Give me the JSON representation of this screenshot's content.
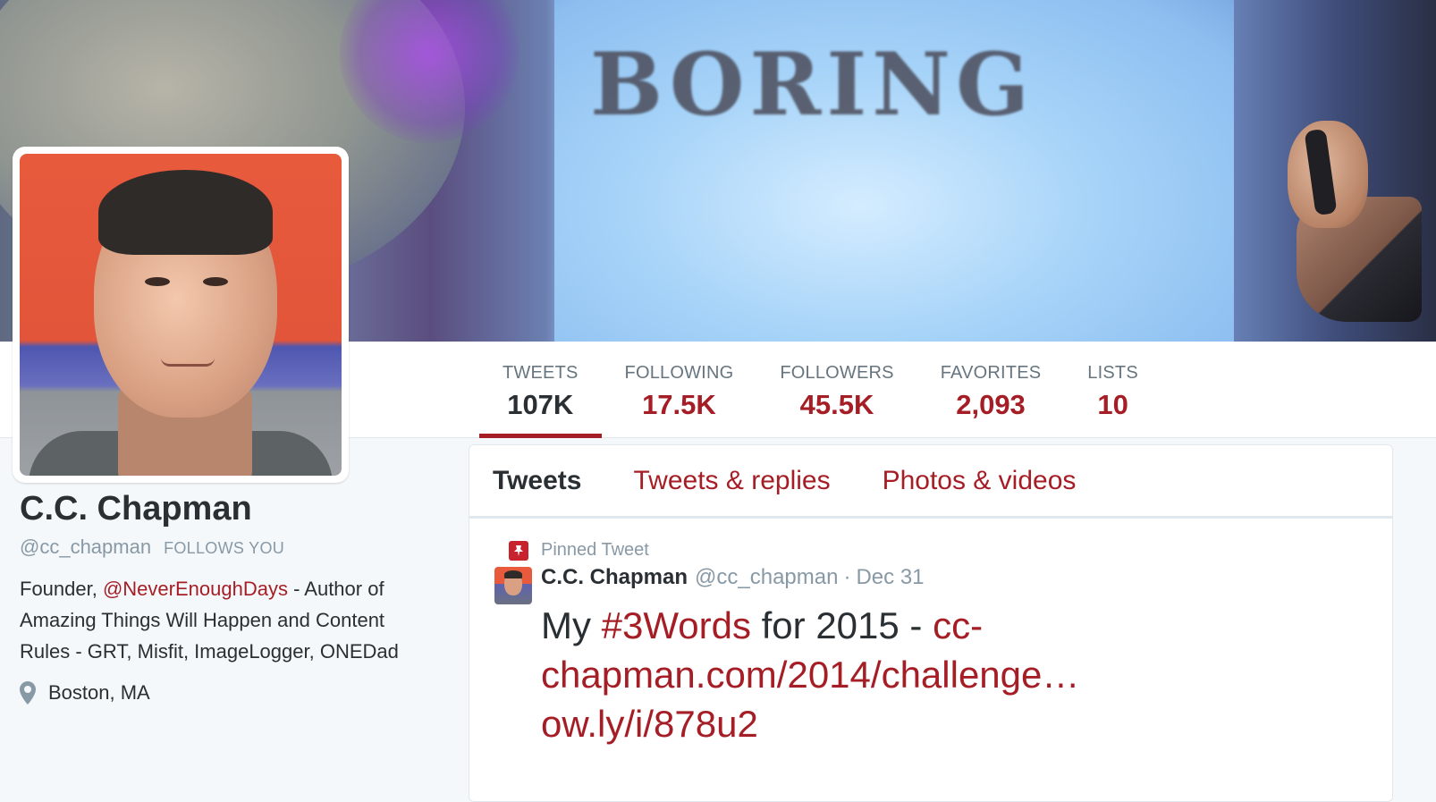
{
  "banner": {
    "text": "BORING"
  },
  "stats": [
    {
      "label": "TWEETS",
      "value": "107K"
    },
    {
      "label": "FOLLOWING",
      "value": "17.5K"
    },
    {
      "label": "FOLLOWERS",
      "value": "45.5K"
    },
    {
      "label": "FAVORITES",
      "value": "2,093"
    },
    {
      "label": "LISTS",
      "value": "10"
    }
  ],
  "profile": {
    "name": "C.C. Chapman",
    "handle": "@cc_chapman",
    "follows_you": "FOLLOWS YOU",
    "bio_prefix": "Founder, ",
    "bio_mention": "@NeverEnoughDays",
    "bio_suffix": " - Author of Amazing Things Will Happen and Content Rules - GRT, Misfit, ImageLogger, ONEDad",
    "location": "Boston, MA",
    "location_icon": "location-pin-icon"
  },
  "timeline": {
    "tabs": [
      "Tweets",
      "Tweets & replies",
      "Photos & videos"
    ],
    "pinned_label": "Pinned Tweet",
    "pinned_icon": "pin-icon",
    "tweet": {
      "name": "C.C. Chapman",
      "handle": "@cc_chapman",
      "separator": "·",
      "date": "Dec 31",
      "text_1": "My ",
      "hashtag": "#3Words",
      "text_2": " for 2015 - ",
      "link_1": "cc-chapman.com/2014/challenge…",
      "link_2": "ow.ly/i/878u2"
    }
  },
  "colors": {
    "accent": "#a51e26",
    "muted": "#8899a6",
    "text": "#292f33"
  }
}
